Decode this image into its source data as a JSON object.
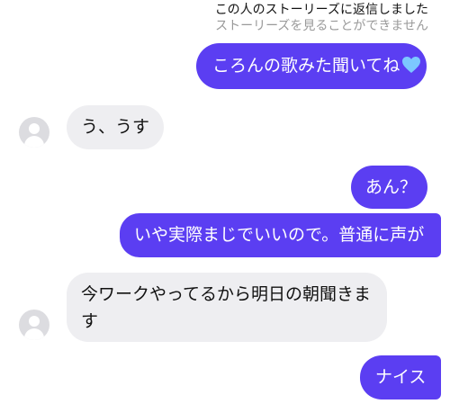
{
  "story_notice": {
    "line1": "この人のストーリーズに返信しました",
    "line2": "ストーリーズを見ることができません"
  },
  "messages": [
    {
      "direction": "outgoing",
      "text": "ころんの歌みた聞いてね",
      "emoji": "light-blue-heart-icon"
    },
    {
      "direction": "incoming",
      "text": "う、うす"
    },
    {
      "direction": "outgoing",
      "text": "あん？"
    },
    {
      "direction": "outgoing",
      "text": "いや実際まじでいいので。普通に声が"
    },
    {
      "direction": "incoming",
      "text_line1": "今ワークやってるから明日の朝聞きま",
      "text_line2": "す"
    },
    {
      "direction": "outgoing",
      "text": "ナイス"
    }
  ],
  "colors": {
    "outgoing_bubble": "#5b3ef2",
    "incoming_bubble": "#eeeef1",
    "heart": "#7cc8ff"
  }
}
